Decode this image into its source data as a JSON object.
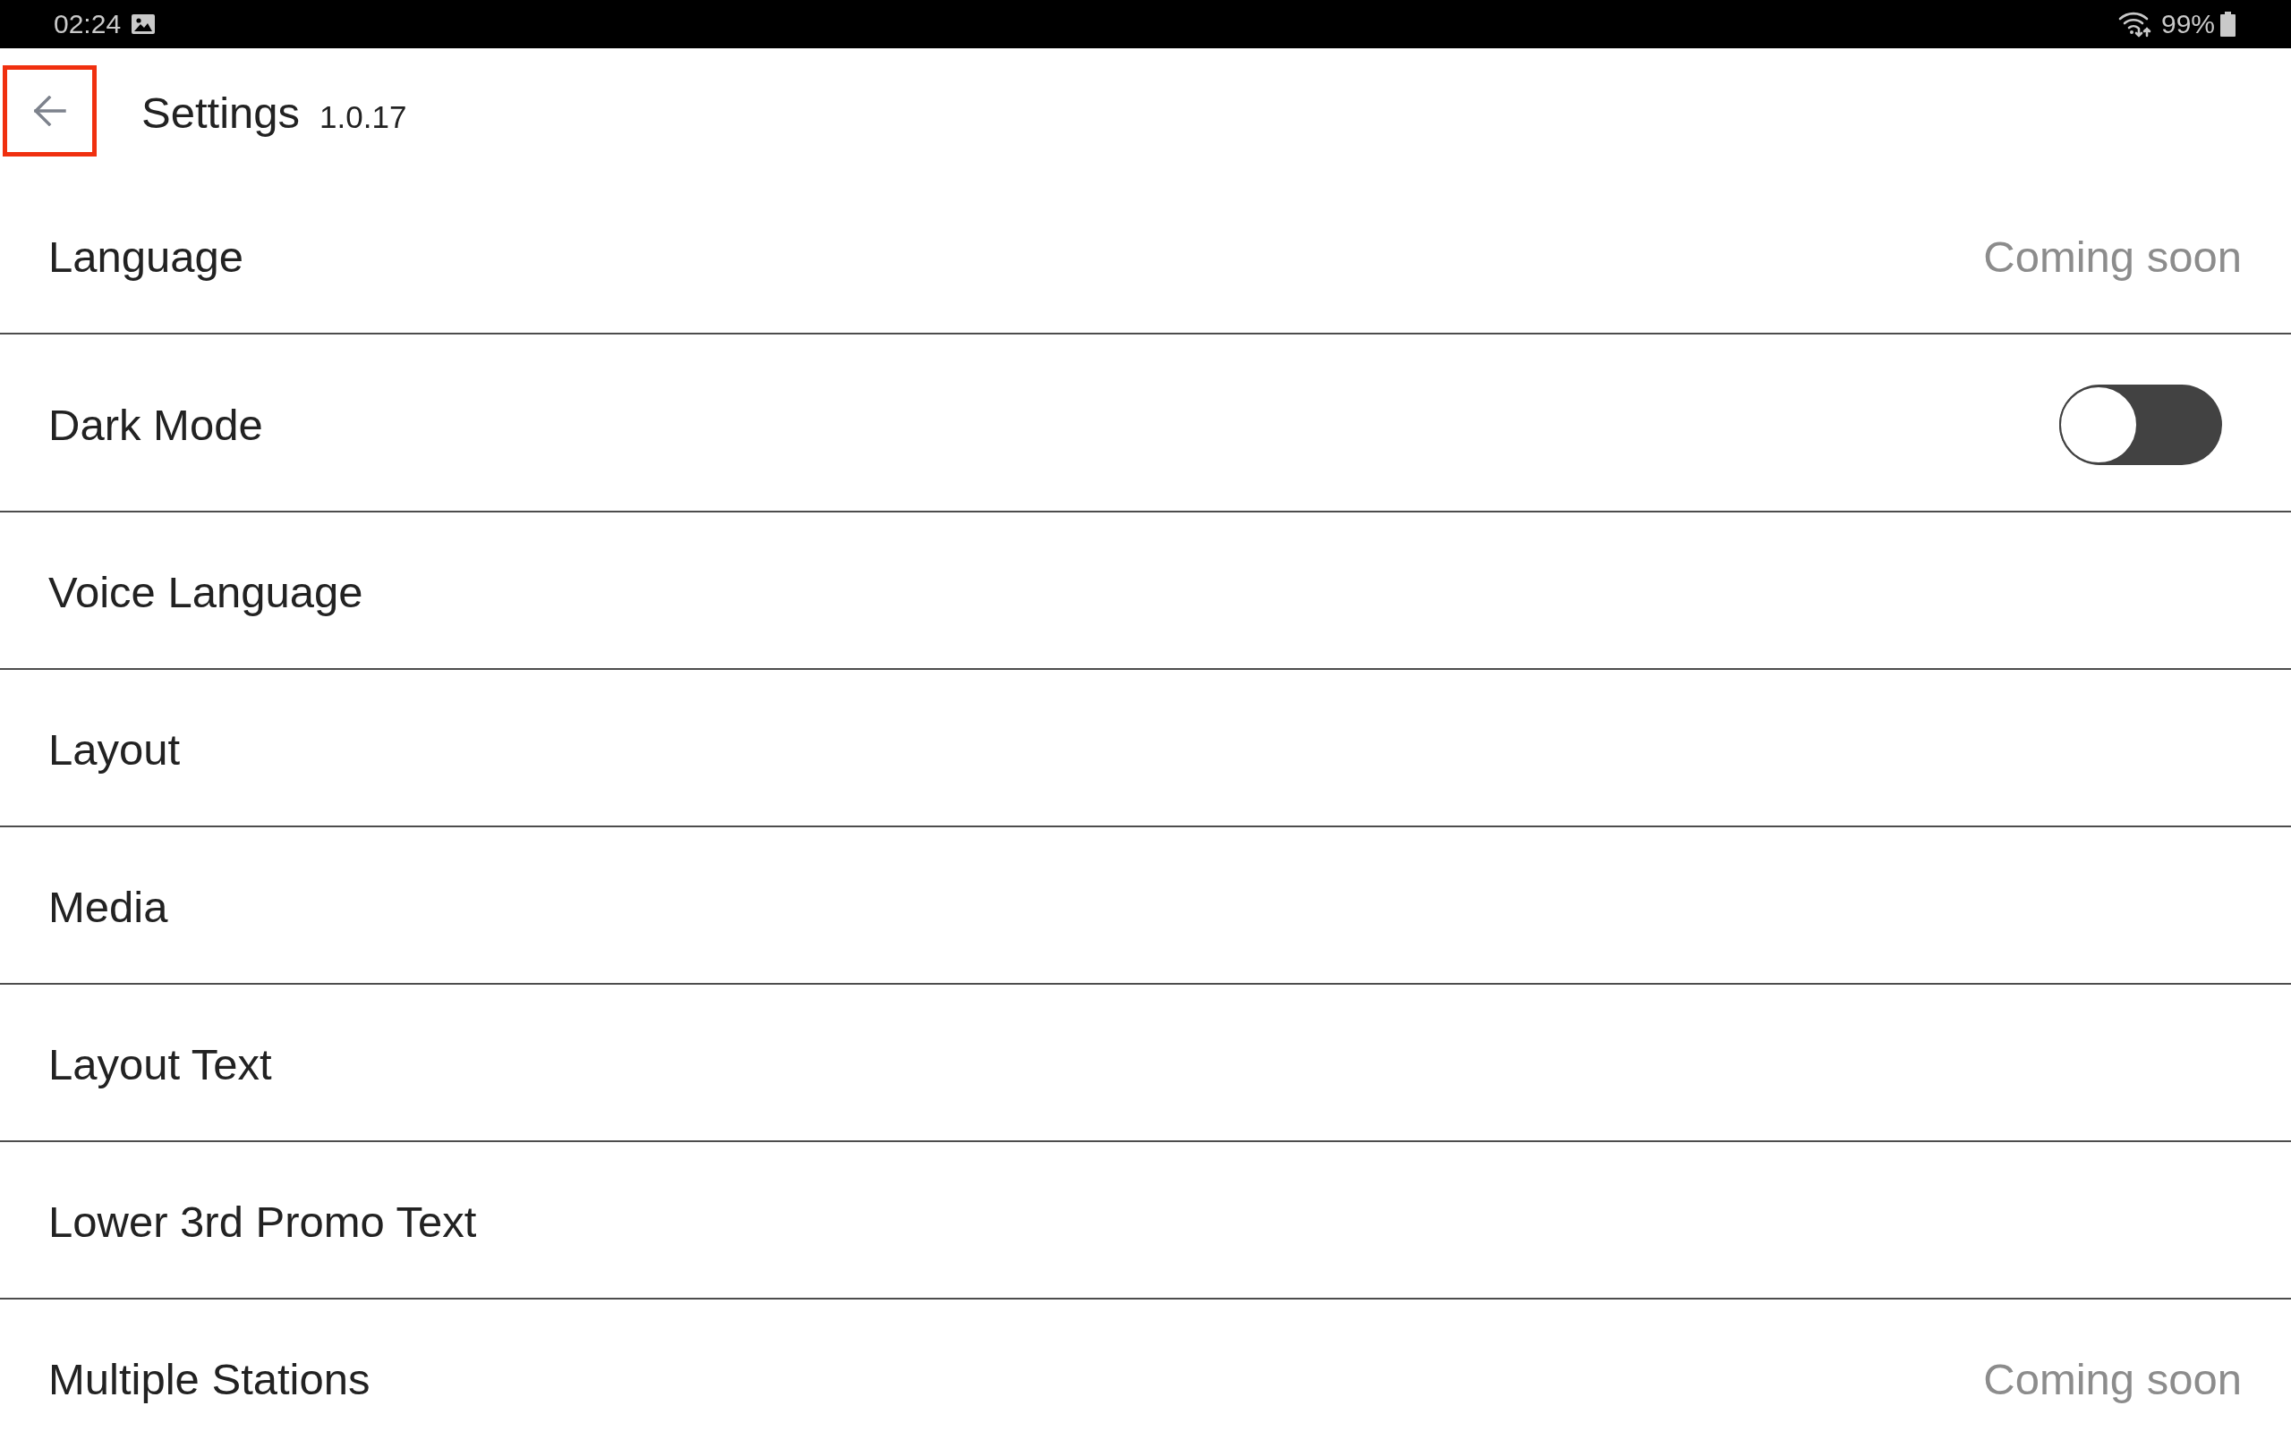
{
  "status_bar": {
    "time": "02:24",
    "battery": "99%"
  },
  "header": {
    "back_button": {
      "highlighted": true
    },
    "title": "Settings",
    "version": "1.0.17"
  },
  "settings": [
    {
      "kind": "value",
      "label": "Language",
      "value": "Coming soon"
    },
    {
      "kind": "switch",
      "label": "Dark Mode",
      "on": false
    },
    {
      "kind": "plain",
      "label": "Voice Language"
    },
    {
      "kind": "plain",
      "label": "Layout"
    },
    {
      "kind": "plain",
      "label": "Media"
    },
    {
      "kind": "plain",
      "label": "Layout Text"
    },
    {
      "kind": "plain",
      "label": "Lower 3rd Promo Text"
    },
    {
      "kind": "value",
      "label": "Multiple Stations",
      "value": "Coming soon"
    }
  ]
}
